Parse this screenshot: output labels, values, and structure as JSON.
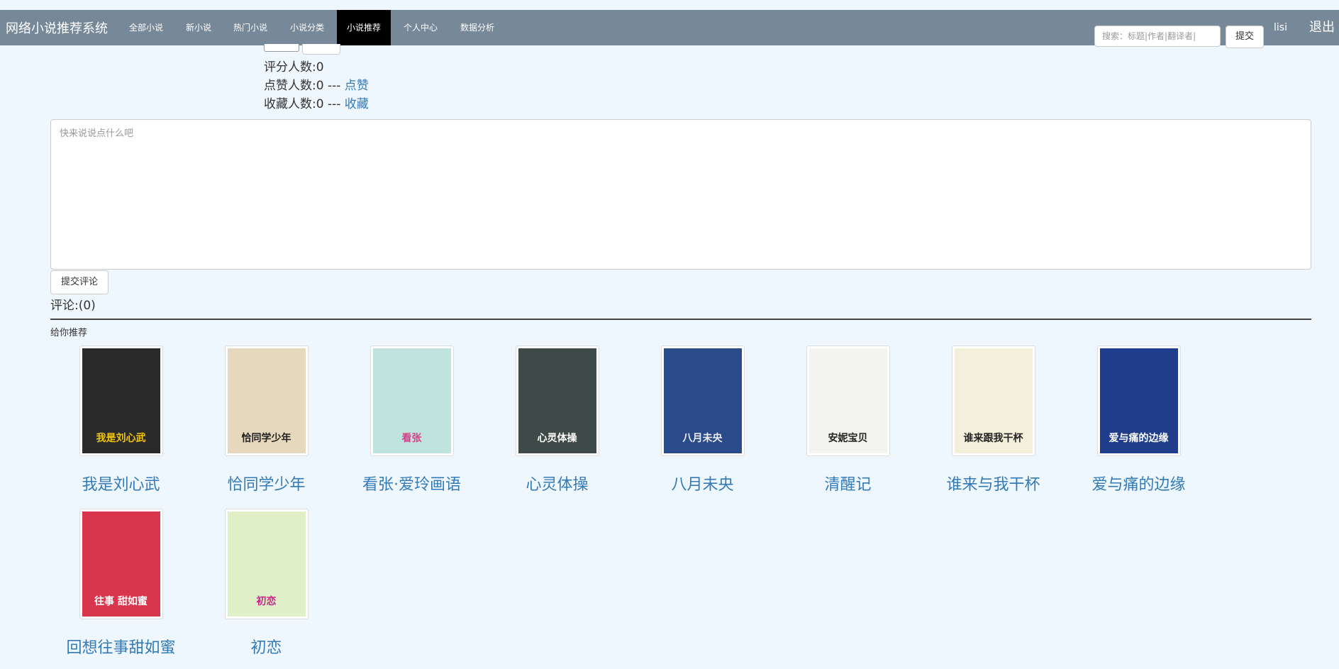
{
  "navbar": {
    "brand": "网络小说推荐系统",
    "items": [
      {
        "label": "全部小说"
      },
      {
        "label": "新小说"
      },
      {
        "label": "热门小说"
      },
      {
        "label": "小说分类"
      },
      {
        "label": "小说推荐",
        "active": true
      },
      {
        "label": "个人中心"
      },
      {
        "label": "数据分析"
      }
    ],
    "search_placeholder": "搜索：标题|作者|翻译者|",
    "search_button": "提交",
    "user": "lisi",
    "logout": "退出"
  },
  "stats": {
    "rating_count": "评分人数:0",
    "like_count": "点赞人数:0 --- ",
    "like_link": "点赞",
    "fav_count": "收藏人数:0 --- ",
    "fav_link": "收藏"
  },
  "comment": {
    "placeholder": "快来说说点什么吧",
    "submit": "提交评论",
    "count": "评论:(0)"
  },
  "recommend": {
    "title": "给你推荐",
    "books": [
      {
        "title": "我是刘心武",
        "cover_text": "我是刘心武",
        "bg": "#2a2a2a",
        "fg": "#f1c40f"
      },
      {
        "title": "恰同学少年",
        "cover_text": "恰同学少年",
        "bg": "#e6d8bd",
        "fg": "#222"
      },
      {
        "title": "看张·爱玲画语",
        "cover_text": "看张",
        "bg": "#bfe3dd",
        "fg": "#d23f8a"
      },
      {
        "title": "心灵体操",
        "cover_text": "心灵体操",
        "bg": "#3d4a48",
        "fg": "#fff"
      },
      {
        "title": "八月未央",
        "cover_text": "八月未央",
        "bg": "#2b4a8a",
        "fg": "#eee"
      },
      {
        "title": "清醒记",
        "cover_text": "安妮宝贝",
        "bg": "#f3f3ef",
        "fg": "#222"
      },
      {
        "title": "谁来与我干杯",
        "cover_text": "谁来跟我干杯",
        "bg": "#f4efdb",
        "fg": "#222"
      },
      {
        "title": "爱与痛的边缘",
        "cover_text": "爱与痛的边缘",
        "bg": "#1f3d8a",
        "fg": "#fff"
      },
      {
        "title": "回想往事甜如蜜",
        "cover_text": "往事 甜如蜜",
        "bg": "#d8364c",
        "fg": "#fff"
      },
      {
        "title": "初恋",
        "cover_text": "初恋",
        "bg": "#dff0c8",
        "fg": "#c8248a"
      }
    ]
  }
}
